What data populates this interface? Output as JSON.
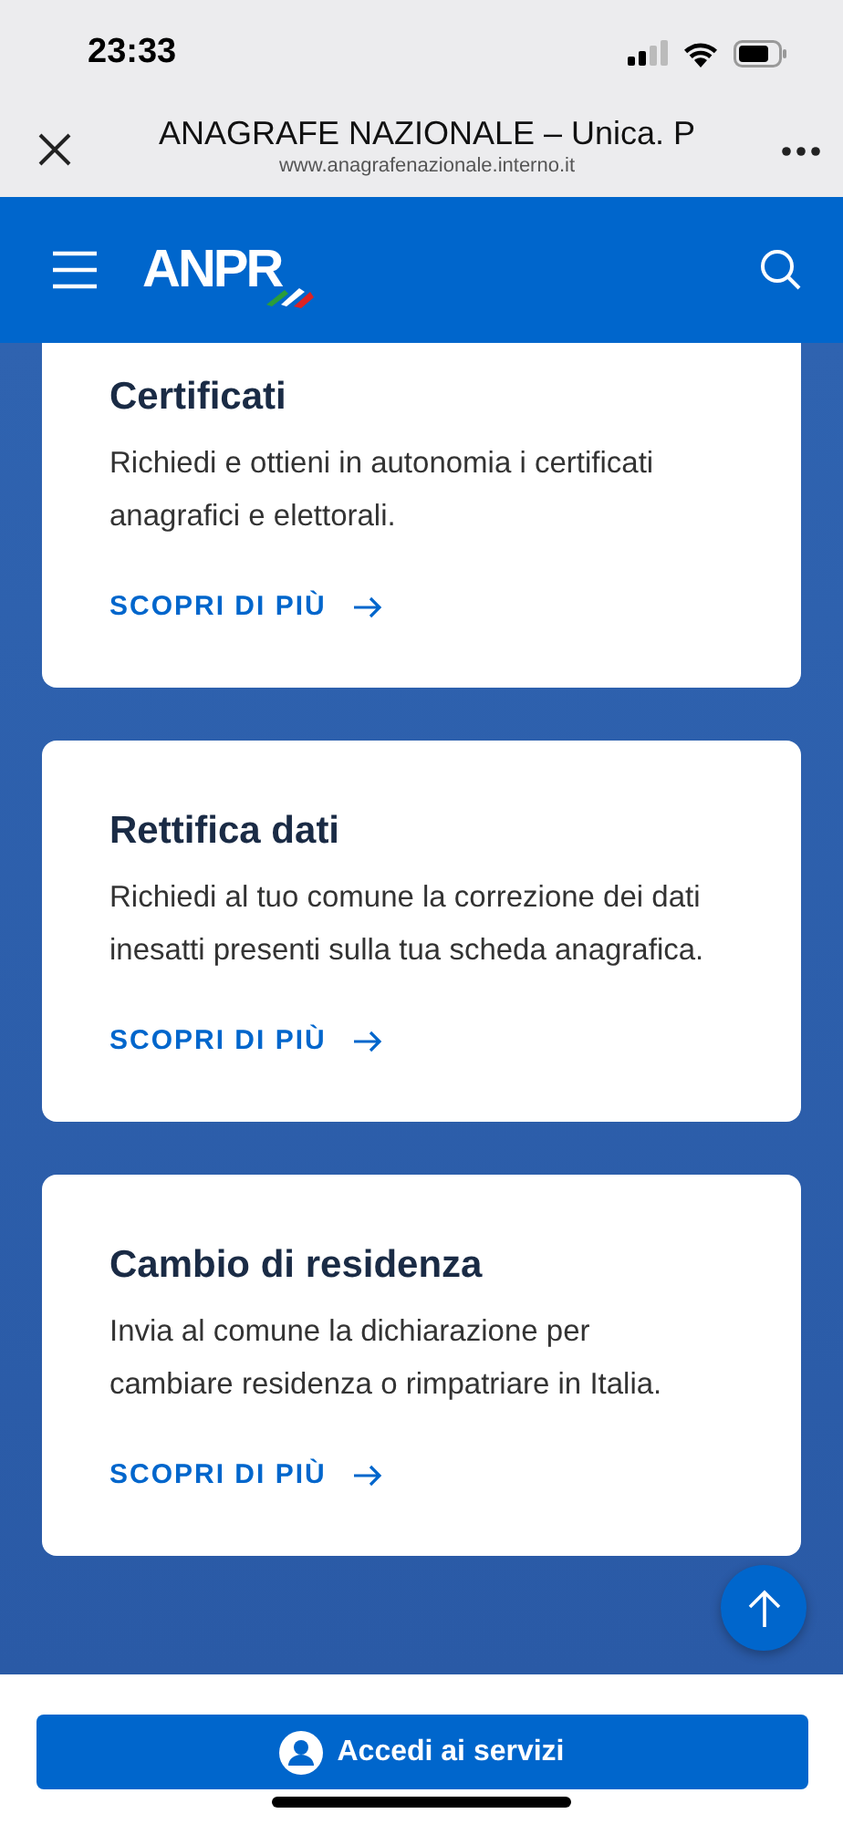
{
  "status_bar": {
    "time": "23:33"
  },
  "browser": {
    "title": "ANAGRAFE NAZIONALE – Unica. P",
    "url": "www.anagrafenazionale.interno.it"
  },
  "header": {
    "logo": "ANPR"
  },
  "cards": [
    {
      "title": "Certificati",
      "text": "Richiedi e ottieni in autonomia i certificati anagrafici e elettorali.",
      "link": "SCOPRI DI PIÙ",
      "cut_top": true
    },
    {
      "title": "Rettifica dati",
      "text": "Richiedi al tuo comune la correzione dei dati inesatti presenti sulla tua scheda anagrafica.",
      "link": "SCOPRI DI PIÙ",
      "cut_top": false
    },
    {
      "title": "Cambio di residenza",
      "text": "Invia al comune la dichiarazione per cambiare residenza o rimpatriare in Italia.",
      "link": "SCOPRI DI PIÙ",
      "cut_top": false
    }
  ],
  "login_button": {
    "label": "Accedi ai servizi"
  }
}
